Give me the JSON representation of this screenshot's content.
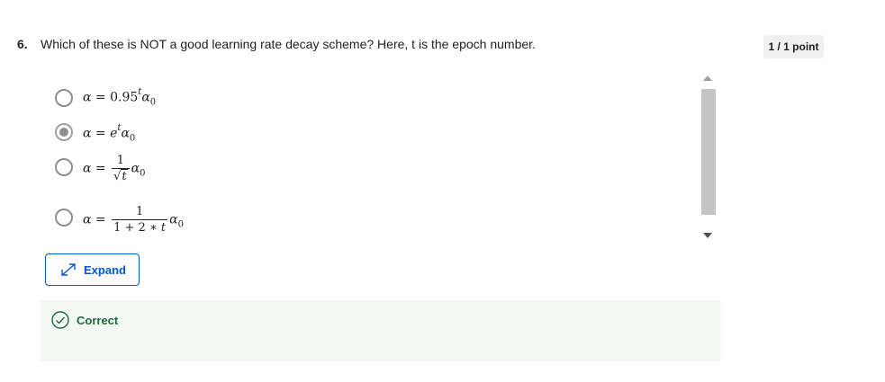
{
  "question": {
    "number": "6.",
    "text": "Which of these is NOT a good learning rate decay scheme? Here, t is the epoch number.",
    "points": "1 / 1 point"
  },
  "options": [
    {
      "id": "opt1",
      "formula": "α = 0.95^t α0",
      "selected": false
    },
    {
      "id": "opt2",
      "formula": "α = e^t α0",
      "selected": true
    },
    {
      "id": "opt3",
      "formula": "α = 1/√t α0",
      "selected": false
    },
    {
      "id": "opt4",
      "formula": "α = 1/(1+2*t) α0",
      "selected": false
    }
  ],
  "math": {
    "alpha": "α",
    "eq": "=",
    "alpha0": "α",
    "zero": "0",
    "base095": "0.95",
    "e": "e",
    "t": "t",
    "one": "1",
    "den4": "1 + 2 ∗ ",
    "sqrt": "√"
  },
  "expand": {
    "label": "Expand",
    "icon": "expand-arrows-icon"
  },
  "feedback": {
    "label": "Correct",
    "icon": "check-circle-icon",
    "color": "#1d6b3c"
  },
  "colors": {
    "accent": "#0056d2",
    "feedback_bg": "#f3f8f4",
    "radio_border": "#8e8e8e"
  }
}
